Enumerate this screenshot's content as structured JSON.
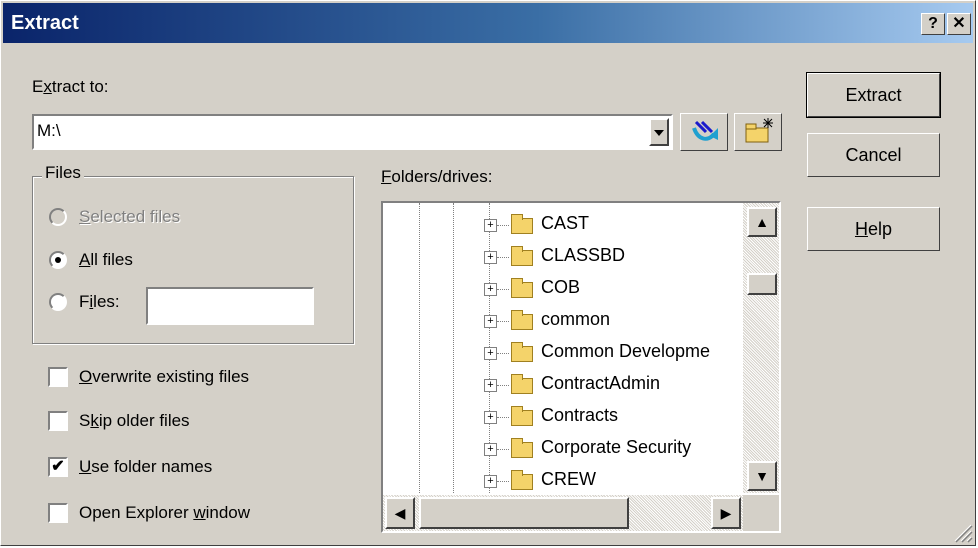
{
  "window": {
    "title": "Extract",
    "help_button": "?",
    "close_button": "✕"
  },
  "extract_to": {
    "label_prefix": "E",
    "label_underline": "x",
    "label_rest": "tract to:",
    "value": "M:\\"
  },
  "buttons": {
    "extract": "Extract",
    "cancel": "Cancel",
    "help_underline": "H",
    "help_rest": "elp"
  },
  "files_group": {
    "title": "Files",
    "selected_underline": "S",
    "selected_rest": "elected files",
    "all_underline": "A",
    "all_rest": "ll files",
    "files_prefix": "F",
    "files_underline": "i",
    "files_rest": "les:",
    "files_value": "",
    "selection": "all"
  },
  "options": [
    {
      "pre": "",
      "ul": "O",
      "post": "verwrite existing files",
      "checked": false
    },
    {
      "pre": "S",
      "ul": "k",
      "post": "ip older files",
      "checked": false
    },
    {
      "pre": "",
      "ul": "U",
      "post": "se folder names",
      "checked": true
    },
    {
      "pre": "Open Explorer ",
      "ul": "w",
      "post": "indow",
      "checked": false
    }
  ],
  "folders": {
    "label_underline": "F",
    "label_rest": "olders/drives:",
    "items": [
      "CAST",
      "CLASSBD",
      "COB",
      "common",
      "Common Developme",
      "ContractAdmin",
      "Contracts",
      "Corporate Security",
      "CREW"
    ]
  },
  "icons": {
    "dropdown": "chevron-down-icon",
    "up_folder": "up-one-level-icon",
    "new_folder": "new-folder-icon",
    "folder": "folder-icon"
  }
}
